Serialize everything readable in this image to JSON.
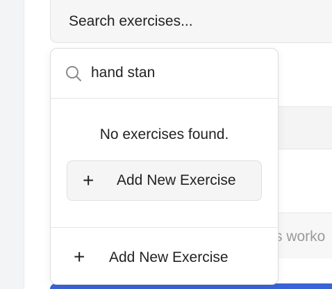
{
  "search": {
    "placeholder": "Search exercises..."
  },
  "background": {
    "visible_placeholder_fragment": "s worko"
  },
  "dropdown": {
    "query": "hand stan",
    "empty_message": "No exercises found.",
    "add_inline_label": "Add New Exercise",
    "add_footer_label": "Add New Exercise",
    "plus_glyph": "+"
  },
  "colors": {
    "accent_blue": "#3b63d8"
  }
}
